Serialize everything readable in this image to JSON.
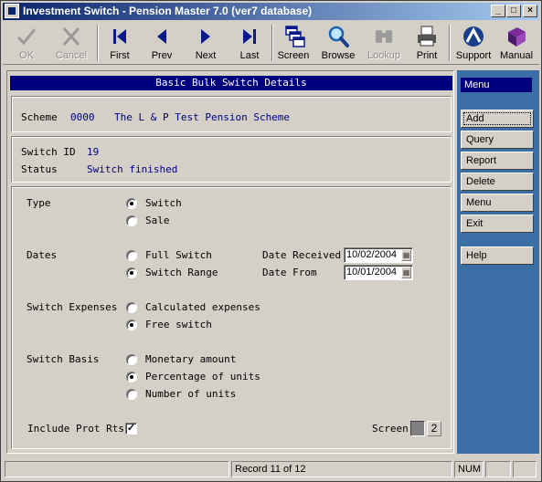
{
  "window": {
    "title": "Investment Switch - Pension Master 7.0 (ver7 database)",
    "controls": {
      "minimize": "_",
      "maximize": "□",
      "close": "×"
    }
  },
  "toolbar": [
    {
      "label": "OK",
      "icon": "checkmark-icon",
      "enabled": false
    },
    {
      "label": "Cancel",
      "icon": "x-cancel-icon",
      "enabled": false
    },
    {
      "label": "First",
      "icon": "first-record-icon",
      "enabled": true
    },
    {
      "label": "Prev",
      "icon": "previous-icon",
      "enabled": true
    },
    {
      "label": "Next",
      "icon": "next-icon",
      "enabled": true
    },
    {
      "label": "Last",
      "icon": "last-record-icon",
      "enabled": true
    },
    {
      "label": "Screen",
      "icon": "screens-icon",
      "enabled": true
    },
    {
      "label": "Browse",
      "icon": "magnifier-icon",
      "enabled": true
    },
    {
      "label": "Lookup",
      "icon": "binoculars-icon",
      "enabled": false
    },
    {
      "label": "Print",
      "icon": "printer-icon",
      "enabled": true
    },
    {
      "label": "Support",
      "icon": "support-icon",
      "enabled": true
    },
    {
      "label": "Manual",
      "icon": "book-icon",
      "enabled": true
    }
  ],
  "form": {
    "header": "Basic Bulk Switch Details",
    "scheme": {
      "label": "Scheme",
      "code": "0000",
      "name": "The L & P Test Pension Scheme"
    },
    "switch_id": {
      "label": "Switch ID",
      "value": "19"
    },
    "status": {
      "label": "Status",
      "value": "Switch finished"
    },
    "type": {
      "label": "Type",
      "options": [
        "Switch",
        "Sale"
      ],
      "selected": 0
    },
    "dates": {
      "label": "Dates",
      "options": [
        "Full Switch",
        "Switch Range"
      ],
      "selected": 1
    },
    "date_received": {
      "label": "Date Received",
      "value": "10/02/2004"
    },
    "date_from": {
      "label": "Date From",
      "value": "10/01/2004"
    },
    "switch_expenses": {
      "label": "Switch Expenses",
      "options": [
        "Calculated expenses",
        "Free switch"
      ],
      "selected": 1
    },
    "switch_basis": {
      "label": "Switch Basis",
      "options": [
        "Monetary amount",
        "Percentage of units",
        "Number of units"
      ],
      "selected": 1
    },
    "include_prot_rts": {
      "label": "Include Prot Rts",
      "checked": true,
      "mark": "✓"
    },
    "screen": {
      "label": "Screen",
      "value": "2"
    }
  },
  "side_menu": {
    "header": "Menu",
    "buttons": [
      "Add",
      "Query",
      "Report",
      "Delete",
      "Menu",
      "Exit"
    ],
    "help": "Help"
  },
  "statusbar": {
    "record": "Record 11 of 12",
    "num": "NUM"
  },
  "colors": {
    "title_start": "#0a246a",
    "title_end": "#a6caf0",
    "side_panel": "#3a6ea5",
    "header_navy": "#00007f",
    "value_blue": "#00007f"
  }
}
